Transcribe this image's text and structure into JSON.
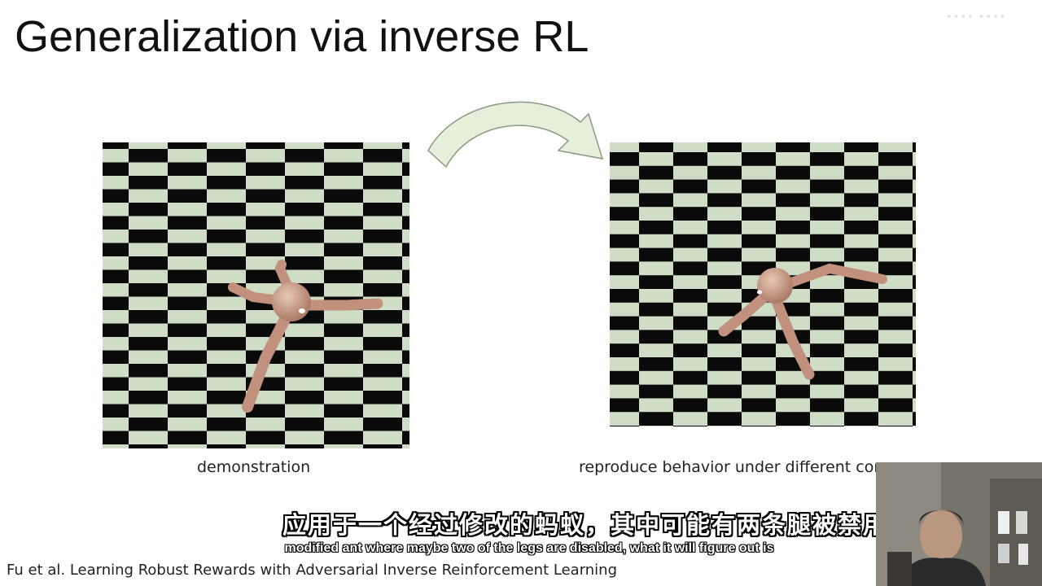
{
  "slide": {
    "title": "Generalization via inverse RL",
    "left_caption": "demonstration",
    "right_caption": "reproduce behavior under different conditions",
    "citation": "Fu et al. Learning Robust Rewards with Adversarial Inverse Reinforcement Learning"
  },
  "subtitles": {
    "chinese": "应用于一个经过修改的蚂蚁，其中可能有两条腿被禁用，它",
    "english": "modified ant where maybe two of the legs are disabled, what it will figure out is"
  },
  "colors": {
    "checker_light": "#cfdcc6",
    "checker_dark": "#0a0a0a",
    "ant_body": "#c89a86",
    "arrow_fill": "#e7efdc",
    "arrow_stroke": "#8a9a80"
  }
}
